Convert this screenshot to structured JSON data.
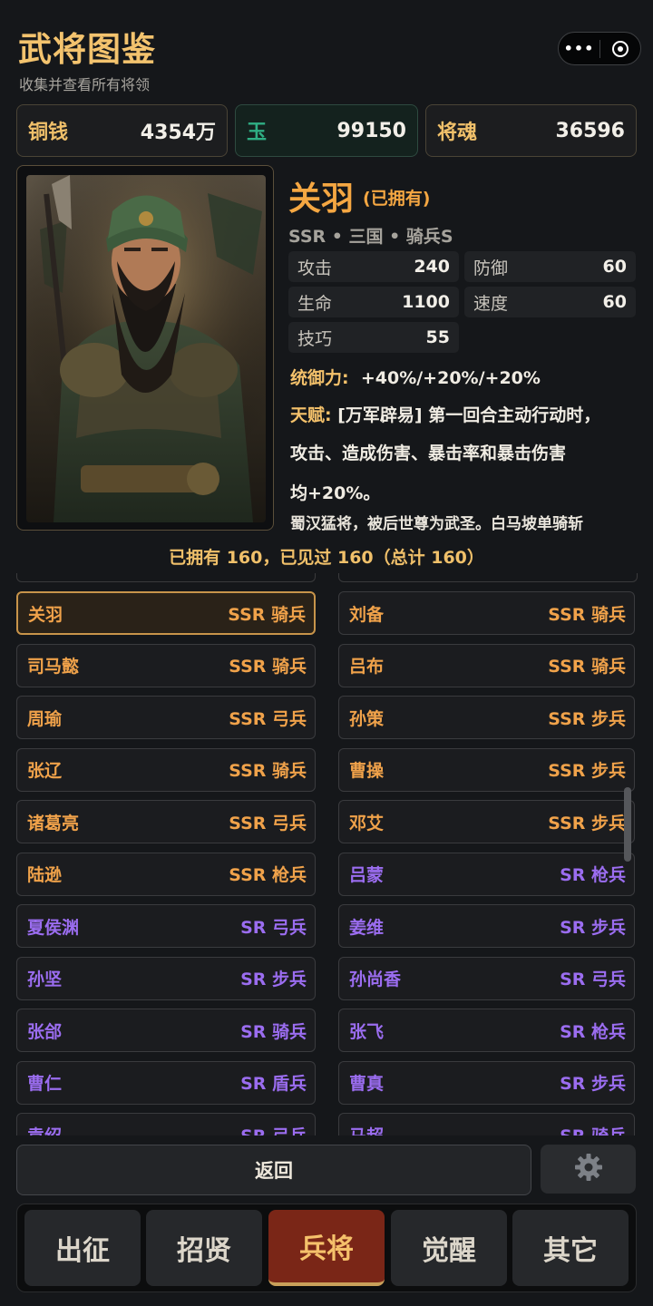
{
  "header": {
    "title": "武将图鉴",
    "subtitle": "收集并查看所有将领",
    "capsule_more": "•••"
  },
  "currencies": [
    {
      "label": "铜钱",
      "value": "4354万"
    },
    {
      "label": "玉",
      "value": "99150"
    },
    {
      "label": "将魂",
      "value": "36596"
    }
  ],
  "hero": {
    "name": "关羽",
    "owned_tag": "(已拥有)",
    "meta": "SSR • 三国 • 骑兵S",
    "stats": [
      {
        "label": "攻击",
        "value": "240"
      },
      {
        "label": "防御",
        "value": "60"
      },
      {
        "label": "生命",
        "value": "1100"
      },
      {
        "label": "速度",
        "value": "60"
      },
      {
        "label": "技巧",
        "value": "55"
      }
    ],
    "command_label": "统御力:",
    "command_value": "+40%/+20%/+20%",
    "talent_label": "天赋:",
    "talent_line1": "[万军辟易] 第一回合主动行动时，",
    "talent_line2": "攻击、造成伤害、暴击率和暴击伤害",
    "talent_line3": "均+20%。",
    "lore": "蜀汉猛将，被后世尊为武圣。白马坡单骑斩"
  },
  "summary": "已拥有 160，已见过 160（总计 160）",
  "generals": {
    "left": [
      {
        "name": "关羽",
        "rank": "SSR 骑兵",
        "tier": "ssr",
        "selected": true
      },
      {
        "name": "司马懿",
        "rank": "SSR 骑兵",
        "tier": "ssr"
      },
      {
        "name": "周瑜",
        "rank": "SSR 弓兵",
        "tier": "ssr"
      },
      {
        "name": "张辽",
        "rank": "SSR 骑兵",
        "tier": "ssr"
      },
      {
        "name": "诸葛亮",
        "rank": "SSR 弓兵",
        "tier": "ssr"
      },
      {
        "name": "陆逊",
        "rank": "SSR 枪兵",
        "tier": "ssr"
      },
      {
        "name": "夏侯渊",
        "rank": "SR 弓兵",
        "tier": "sr"
      },
      {
        "name": "孙坚",
        "rank": "SR 步兵",
        "tier": "sr"
      },
      {
        "name": "张郃",
        "rank": "SR 骑兵",
        "tier": "sr"
      },
      {
        "name": "曹仁",
        "rank": "SR 盾兵",
        "tier": "sr"
      },
      {
        "name": "袁绍",
        "rank": "SR 弓兵",
        "tier": "sr"
      }
    ],
    "right": [
      {
        "name": "刘备",
        "rank": "SSR 骑兵",
        "tier": "ssr"
      },
      {
        "name": "吕布",
        "rank": "SSR 骑兵",
        "tier": "ssr"
      },
      {
        "name": "孙策",
        "rank": "SSR 步兵",
        "tier": "ssr"
      },
      {
        "name": "曹操",
        "rank": "SSR 步兵",
        "tier": "ssr"
      },
      {
        "name": "邓艾",
        "rank": "SSR 步兵",
        "tier": "ssr"
      },
      {
        "name": "吕蒙",
        "rank": "SR 枪兵",
        "tier": "sr"
      },
      {
        "name": "姜维",
        "rank": "SR 步兵",
        "tier": "sr"
      },
      {
        "name": "孙尚香",
        "rank": "SR 弓兵",
        "tier": "sr"
      },
      {
        "name": "张飞",
        "rank": "SR 枪兵",
        "tier": "sr"
      },
      {
        "name": "曹真",
        "rank": "SR 步兵",
        "tier": "sr"
      },
      {
        "name": "马超",
        "rank": "SR 骑兵",
        "tier": "sr"
      }
    ]
  },
  "buttons": {
    "back": "返回"
  },
  "tabs": [
    {
      "label": "出征"
    },
    {
      "label": "招贤"
    },
    {
      "label": "兵将",
      "active": true
    },
    {
      "label": "觉醒"
    },
    {
      "label": "其它"
    }
  ],
  "colors": {
    "accent_gold": "#f0c06a",
    "hero_orange": "#f5a742",
    "ssr": "#f0a24a",
    "sr": "#9b6df0",
    "jade": "#2fae84",
    "active_tab": "#7a2617"
  },
  "icons": [
    "more-dots-icon",
    "close-target-icon",
    "gear-icon"
  ]
}
